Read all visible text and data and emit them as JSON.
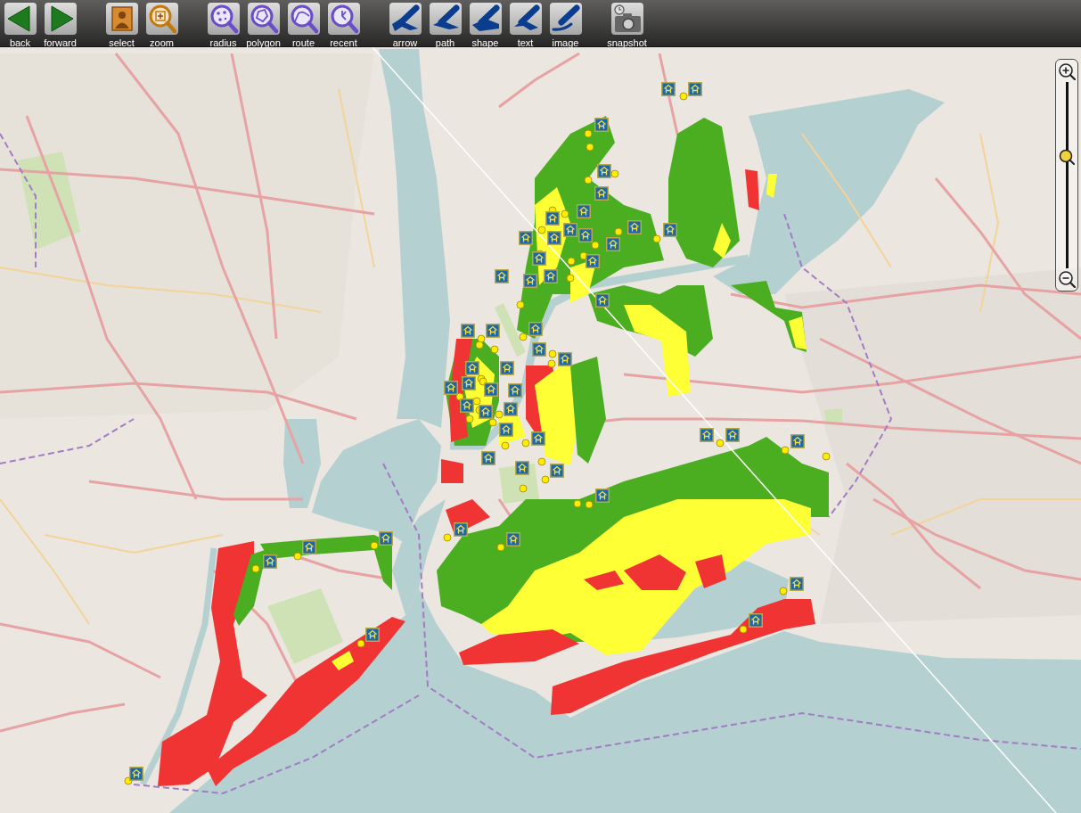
{
  "toolbar": {
    "groups": [
      {
        "buttons": [
          {
            "label": "back",
            "kind": "back"
          },
          {
            "label": "forward",
            "kind": "forward"
          }
        ]
      },
      {
        "buttons": [
          {
            "label": "select",
            "kind": "select"
          },
          {
            "label": "zoom",
            "kind": "zoom"
          }
        ]
      },
      {
        "buttons": [
          {
            "label": "radius",
            "kind": "radius"
          },
          {
            "label": "polygon",
            "kind": "polygon"
          },
          {
            "label": "route",
            "kind": "route"
          },
          {
            "label": "recent",
            "kind": "recent"
          }
        ]
      },
      {
        "buttons": [
          {
            "label": "arrow",
            "kind": "arrow"
          },
          {
            "label": "path",
            "kind": "path"
          },
          {
            "label": "shape",
            "kind": "shape"
          },
          {
            "label": "text",
            "kind": "text"
          },
          {
            "label": "image",
            "kind": "image"
          }
        ]
      },
      {
        "buttons": [
          {
            "label": "snapshot",
            "kind": "snapshot"
          }
        ]
      }
    ]
  },
  "zoom_slider": {
    "level": 0.6
  }
}
